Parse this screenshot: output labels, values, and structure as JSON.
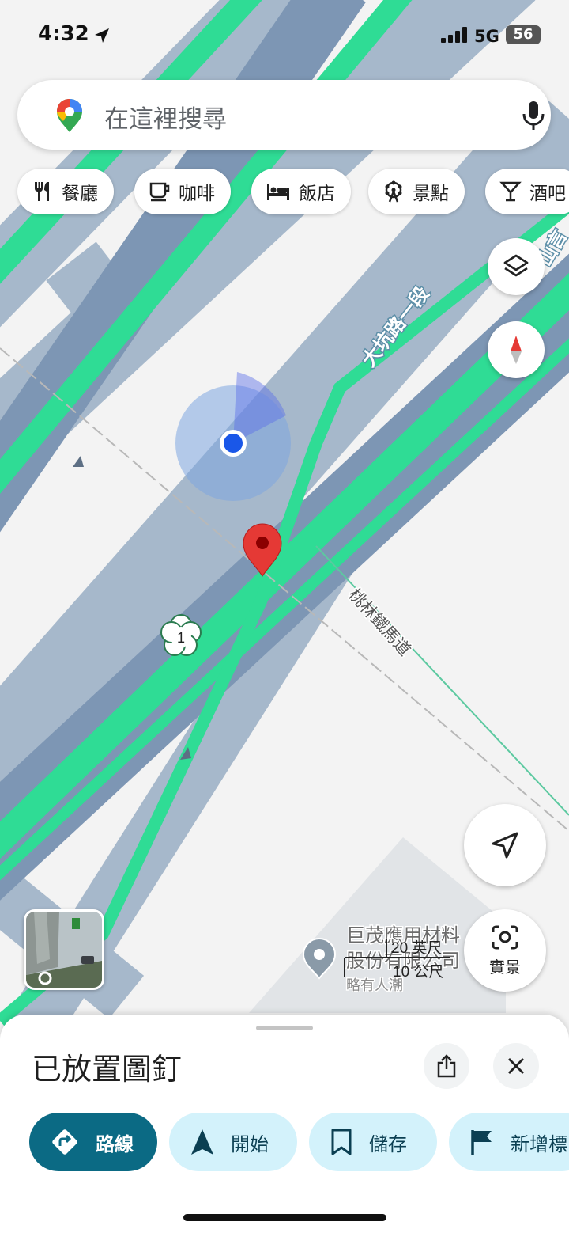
{
  "status_bar": {
    "time": "4:32",
    "network": "5G",
    "battery": "56"
  },
  "search": {
    "placeholder": "在這裡搜尋"
  },
  "chips": [
    {
      "label": "餐廳",
      "icon": "fork-knife-icon"
    },
    {
      "label": "咖啡",
      "icon": "coffee-cup-icon"
    },
    {
      "label": "飯店",
      "icon": "bed-icon"
    },
    {
      "label": "景點",
      "icon": "ferris-wheel-icon"
    },
    {
      "label": "酒吧",
      "icon": "cocktail-icon"
    }
  ],
  "map": {
    "road_label": "大坑路一段",
    "road_label_partial": "山言",
    "rail_label": "桃林鐵馬道",
    "route_shield": "1",
    "poi": {
      "name_line1": "巨茂應用材料",
      "name_line2": "股份有限公司",
      "subtitle": "略有人潮"
    },
    "scale": {
      "imperial": "20 英尺",
      "metric": "10 公尺"
    },
    "colors": {
      "road": "#7d96b4",
      "road_light": "#a6b8cb",
      "highway": "#2fdc95",
      "pin": "#e53935",
      "location_dot": "#1a57e8"
    }
  },
  "controls": {
    "live_view_label": "實景"
  },
  "sheet": {
    "title": "已放置圖釘",
    "actions": [
      {
        "label": "路線",
        "icon": "directions-icon"
      },
      {
        "label": "開始",
        "icon": "navigation-arrow-icon"
      },
      {
        "label": "儲存",
        "icon": "bookmark-icon"
      },
      {
        "label": "新增標",
        "icon": "flag-icon"
      }
    ]
  }
}
